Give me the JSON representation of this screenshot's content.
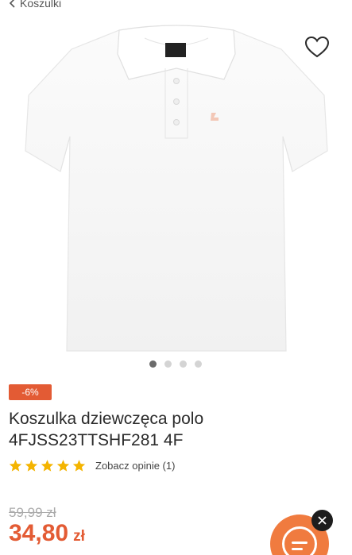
{
  "nav": {
    "back_label": "Koszulki",
    "back_icon": "chevron-left-icon"
  },
  "gallery": {
    "image_alt": "white girls polo shirt",
    "favorite_icon": "heart-icon",
    "slide_count": 4,
    "active_slide": 1
  },
  "product": {
    "discount_badge": "-6%",
    "title": "Koszulka dziewczęca polo 4FJSS23TTSHF281 4F",
    "rating": 5,
    "rating_max": 5,
    "reviews_link": "Zobacz opinie (1)",
    "old_price": "59,99 zł",
    "price": "34,80",
    "currency": "zł"
  },
  "colors": {
    "accent": "#e35b34",
    "star": "#f4b400",
    "chat": "#f07b3f"
  },
  "chat": {
    "icon": "chat-bubble-icon",
    "close_icon": "close-icon"
  }
}
